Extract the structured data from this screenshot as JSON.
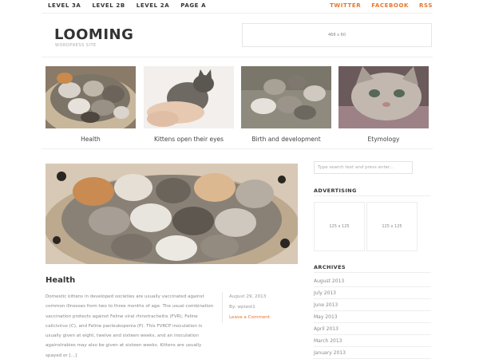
{
  "nav": {
    "left": [
      "LEVEL 3A",
      "LEVEL 2B",
      "LEVEL 2A",
      "PAGE A"
    ],
    "right": [
      "TWITTER",
      "FACEBOOK",
      "RSS"
    ]
  },
  "header": {
    "logo": "LOOMING",
    "tagline": "WORDPRESS SITE",
    "ad_label": "468 x 60"
  },
  "featured": [
    {
      "caption": "Health"
    },
    {
      "caption": "Kittens open their eyes"
    },
    {
      "caption": "Birth and development"
    },
    {
      "caption": "Etymology"
    }
  ],
  "post": {
    "title": "Health",
    "excerpt": "Domestic kittens in developed societies are usually vaccinated against common illnesses from two to three months of age. The usual combination vaccination protects against Feline viral rhinotracheitis (FVR), Feline calicivirus (C), and Feline panleukopenia (P). This FVRCP inoculation is usually given at eight, twelve and sixteen weeks, and an inoculation againstrabies may also be given at sixteen weeks. Kittens are usually spayed or [...]",
    "date": "August 29, 2013",
    "author_prefix": "By",
    "author": "wptest1",
    "comment_link": "Leave a Comment"
  },
  "sidebar": {
    "search_placeholder": "Type search text and press enter...",
    "advertising_title": "ADVERTISING",
    "ad1": "125 x 125",
    "ad2": "125 x 125",
    "archives_title": "ARCHIVES",
    "archives": [
      "August 2013",
      "July 2013",
      "June 2013",
      "May 2013",
      "April 2013",
      "March 2013",
      "January 2013"
    ]
  },
  "colors": {
    "accent": "#e8742a",
    "text_dark": "#333333",
    "text_muted": "#888888"
  }
}
